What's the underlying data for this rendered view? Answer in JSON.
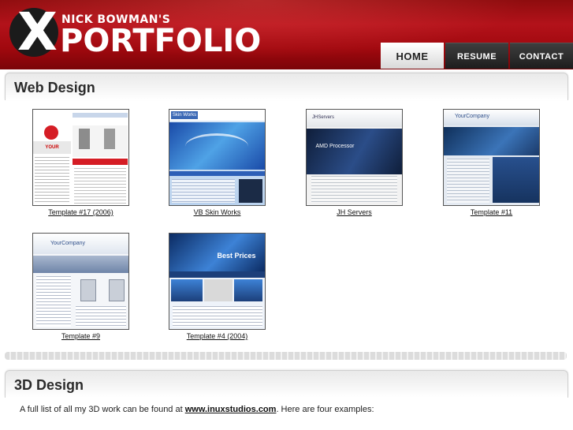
{
  "header": {
    "subtitle": "NICK BOWMAN'S",
    "title": "PORTFOLIO",
    "logo_letter": "X"
  },
  "nav": {
    "home": "HOME",
    "resume": "RESUME",
    "contact": "CONTACT"
  },
  "sections": {
    "web_design_title": "Web Design",
    "three_d_title": "3D Design"
  },
  "templates": [
    {
      "caption": "Template #17 (2006)",
      "screen_text": "YOUR COMPANY"
    },
    {
      "caption": "VB Skin Works",
      "screen_text": "Skin Works"
    },
    {
      "caption": "JH Servers",
      "screen_text": "AMD Processor"
    },
    {
      "caption": "Template #11",
      "screen_text": "YourCompany"
    },
    {
      "caption": "Template #9",
      "screen_text": "YourCompany"
    },
    {
      "caption": "Template #4 (2004)",
      "screen_text": "Best Prices"
    }
  ],
  "intro": {
    "before": "A full list of all my 3D work can be found at ",
    "link": "www.inuxstudios.com",
    "after": ". Here are four examples:"
  },
  "colors": {
    "header_red": "#b3121a",
    "nav_dark": "#1d1d1d",
    "section_title": "#2b2b2b"
  }
}
